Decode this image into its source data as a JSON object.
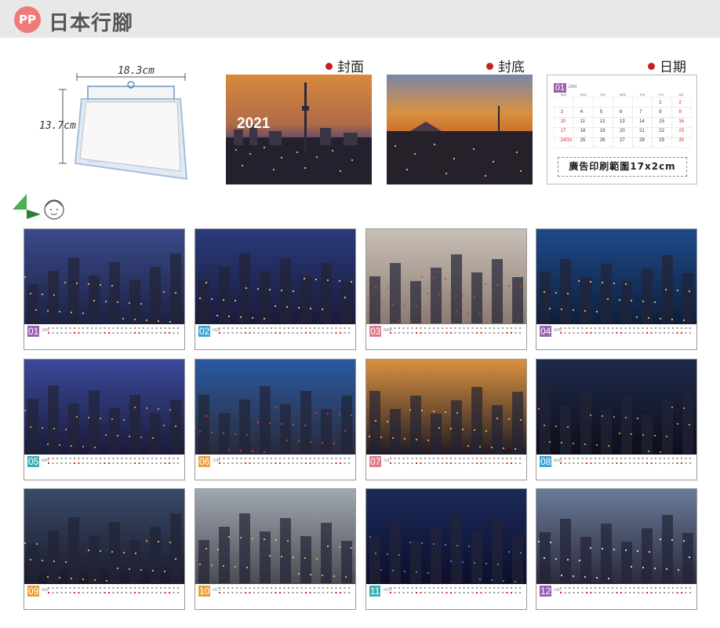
{
  "header": {
    "badge": "PP",
    "title": "日本行腳"
  },
  "stand": {
    "width_label": "18.3cm",
    "height_label": "13.7cm"
  },
  "panels": [
    {
      "label": "封面",
      "year": "2021"
    },
    {
      "label": "封底"
    },
    {
      "label": "日期"
    }
  ],
  "date_sample": {
    "month_num": "01",
    "month_abbr": "JAN",
    "day_names": [
      "SUN",
      "MON",
      "TUE",
      "WED",
      "THU",
      "FRI",
      "SAT"
    ],
    "rows": [
      [
        "",
        "",
        "",
        "",
        "",
        "1",
        "2"
      ],
      [
        "3",
        "4",
        "5",
        "6",
        "7",
        "8",
        "9"
      ],
      [
        "10",
        "11",
        "12",
        "13",
        "14",
        "15",
        "16"
      ],
      [
        "17",
        "18",
        "19",
        "20",
        "21",
        "22",
        "23"
      ],
      [
        "24/31",
        "25",
        "26",
        "27",
        "28",
        "29",
        "30"
      ]
    ],
    "ad_area": "廣告印刷範圍17x2cm"
  },
  "months": [
    {
      "num": "01",
      "abbr": "JAN",
      "color": "#9a5fb0"
    },
    {
      "num": "02",
      "abbr": "FEB",
      "color": "#3aa6d6"
    },
    {
      "num": "03",
      "abbr": "MAR",
      "color": "#e07a8a"
    },
    {
      "num": "04",
      "abbr": "APR",
      "color": "#9a5fb0"
    },
    {
      "num": "05",
      "abbr": "MAY",
      "color": "#3ab0b0"
    },
    {
      "num": "06",
      "abbr": "JUN",
      "color": "#e6a23c"
    },
    {
      "num": "07",
      "abbr": "JUL",
      "color": "#e07a8a"
    },
    {
      "num": "08",
      "abbr": "AUG",
      "color": "#3aa6d6"
    },
    {
      "num": "09",
      "abbr": "SEP",
      "color": "#e6a23c"
    },
    {
      "num": "10",
      "abbr": "OCT",
      "color": "#e6a23c"
    },
    {
      "num": "11",
      "abbr": "NOV",
      "color": "#3ab0b0"
    },
    {
      "num": "12",
      "abbr": "DEC",
      "color": "#9a5fb0"
    }
  ]
}
